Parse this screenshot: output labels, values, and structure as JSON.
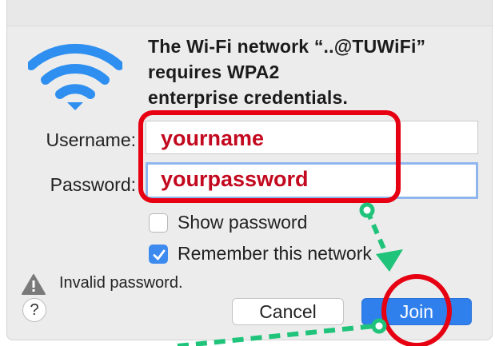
{
  "dialog": {
    "title_lines": [
      "The Wi-Fi network “..@TUWiFi”",
      "requires WPA2",
      "enterprise credentials."
    ],
    "username_label": "Username:",
    "password_label": "Password:",
    "username_value": "yourname",
    "password_value": "yourpassword",
    "show_password_label": "Show password",
    "show_password_checked": false,
    "remember_label": "Remember this network",
    "remember_checked": true,
    "warning_text": "Invalid password.",
    "help_label": "?",
    "cancel_label": "Cancel",
    "join_label": "Join"
  },
  "colors": {
    "annotation_red": "#e60012",
    "annotation_green": "#1fc37a",
    "wifi_blue": "#2e8ff0",
    "join_blue": "#2f80ec"
  },
  "icons": [
    "wifi-icon",
    "warning-icon",
    "checkmark-icon",
    "help-icon"
  ]
}
